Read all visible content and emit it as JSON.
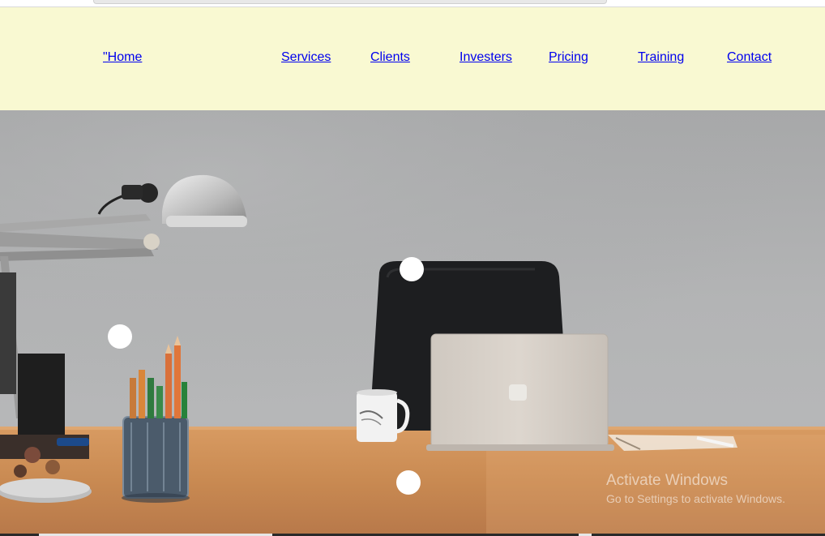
{
  "nav": {
    "items": [
      {
        "label": "\"Home"
      },
      {
        "label": "Services"
      },
      {
        "label": "Clients"
      },
      {
        "label": "Investers"
      },
      {
        "label": "Pricing"
      },
      {
        "label": "Training"
      },
      {
        "label": "Contact"
      }
    ],
    "background": "#f9f9d2",
    "link_color": "#0000ee"
  },
  "hero": {
    "description_icons": [
      "desk-lamp-icon",
      "office-chair-icon",
      "laptop-icon",
      "mug-icon",
      "pencil-cup-icon"
    ],
    "slider_dots": 4
  },
  "watermark": {
    "title": "Activate Windows",
    "subtitle": "Go to Settings to activate Windows."
  }
}
